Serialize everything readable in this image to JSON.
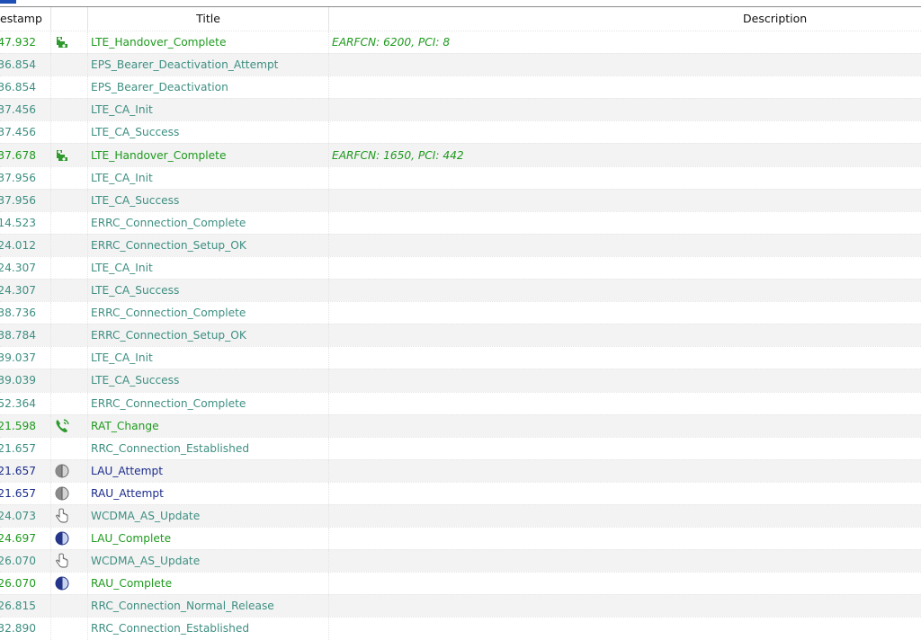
{
  "colors": {
    "green": "#1f9a1f",
    "teal": "#3e8f82",
    "navy": "#1c2c8c"
  },
  "header": {
    "timestamp": "estamp",
    "title": "Title",
    "description": "Description"
  },
  "rows": [
    {
      "ts": ":47.932",
      "icon": "handover-icon",
      "title": "LTE_Handover_Complete",
      "desc": "EARFCN: 6200, PCI: 8",
      "tone": "green"
    },
    {
      "ts": ":36.854",
      "icon": "",
      "title": "EPS_Bearer_Deactivation_Attempt",
      "desc": "",
      "tone": "teal"
    },
    {
      "ts": ":36.854",
      "icon": "",
      "title": "EPS_Bearer_Deactivation",
      "desc": "",
      "tone": "teal"
    },
    {
      "ts": ":37.456",
      "icon": "",
      "title": "LTE_CA_Init",
      "desc": "",
      "tone": "teal"
    },
    {
      "ts": ":37.456",
      "icon": "",
      "title": "LTE_CA_Success",
      "desc": "",
      "tone": "teal"
    },
    {
      "ts": ":37.678",
      "icon": "handover-icon",
      "title": "LTE_Handover_Complete",
      "desc": "EARFCN: 1650, PCI: 442",
      "tone": "green"
    },
    {
      "ts": ":37.956",
      "icon": "",
      "title": "LTE_CA_Init",
      "desc": "",
      "tone": "teal"
    },
    {
      "ts": ":37.956",
      "icon": "",
      "title": "LTE_CA_Success",
      "desc": "",
      "tone": "teal"
    },
    {
      "ts": ":14.523",
      "icon": "",
      "title": "ERRC_Connection_Complete",
      "desc": "",
      "tone": "teal"
    },
    {
      "ts": ":24.012",
      "icon": "",
      "title": "ERRC_Connection_Setup_OK",
      "desc": "",
      "tone": "teal"
    },
    {
      "ts": ":24.307",
      "icon": "",
      "title": "LTE_CA_Init",
      "desc": "",
      "tone": "teal"
    },
    {
      "ts": ":24.307",
      "icon": "",
      "title": "LTE_CA_Success",
      "desc": "",
      "tone": "teal"
    },
    {
      "ts": ":38.736",
      "icon": "",
      "title": "ERRC_Connection_Complete",
      "desc": "",
      "tone": "teal"
    },
    {
      "ts": ":38.784",
      "icon": "",
      "title": "ERRC_Connection_Setup_OK",
      "desc": "",
      "tone": "teal"
    },
    {
      "ts": ":39.037",
      "icon": "",
      "title": "LTE_CA_Init",
      "desc": "",
      "tone": "teal"
    },
    {
      "ts": ":39.039",
      "icon": "",
      "title": "LTE_CA_Success",
      "desc": "",
      "tone": "teal"
    },
    {
      "ts": ":52.364",
      "icon": "",
      "title": "ERRC_Connection_Complete",
      "desc": "",
      "tone": "teal"
    },
    {
      "ts": ":21.598",
      "icon": "phone-icon",
      "title": "RAT_Change",
      "desc": "",
      "tone": "green"
    },
    {
      "ts": ":21.657",
      "icon": "",
      "title": "RRC_Connection_Established",
      "desc": "",
      "tone": "teal"
    },
    {
      "ts": ":21.657",
      "icon": "half-circle-gray-icon",
      "title": "LAU_Attempt",
      "desc": "",
      "tone": "navy"
    },
    {
      "ts": ":21.657",
      "icon": "half-circle-gray-icon",
      "title": "RAU_Attempt",
      "desc": "",
      "tone": "navy"
    },
    {
      "ts": ":24.073",
      "icon": "hand-pointer-icon",
      "title": "WCDMA_AS_Update",
      "desc": "",
      "tone": "teal"
    },
    {
      "ts": ":24.697",
      "icon": "half-circle-blue-icon",
      "title": "LAU_Complete",
      "desc": "",
      "tone": "green"
    },
    {
      "ts": ":26.070",
      "icon": "hand-pointer-icon",
      "title": "WCDMA_AS_Update",
      "desc": "",
      "tone": "teal"
    },
    {
      "ts": ":26.070",
      "icon": "half-circle-blue-icon",
      "title": "RAU_Complete",
      "desc": "",
      "tone": "green"
    },
    {
      "ts": ":26.815",
      "icon": "",
      "title": "RRC_Connection_Normal_Release",
      "desc": "",
      "tone": "teal"
    },
    {
      "ts": ":32.890",
      "icon": "",
      "title": "RRC_Connection_Established",
      "desc": "",
      "tone": "teal"
    }
  ]
}
